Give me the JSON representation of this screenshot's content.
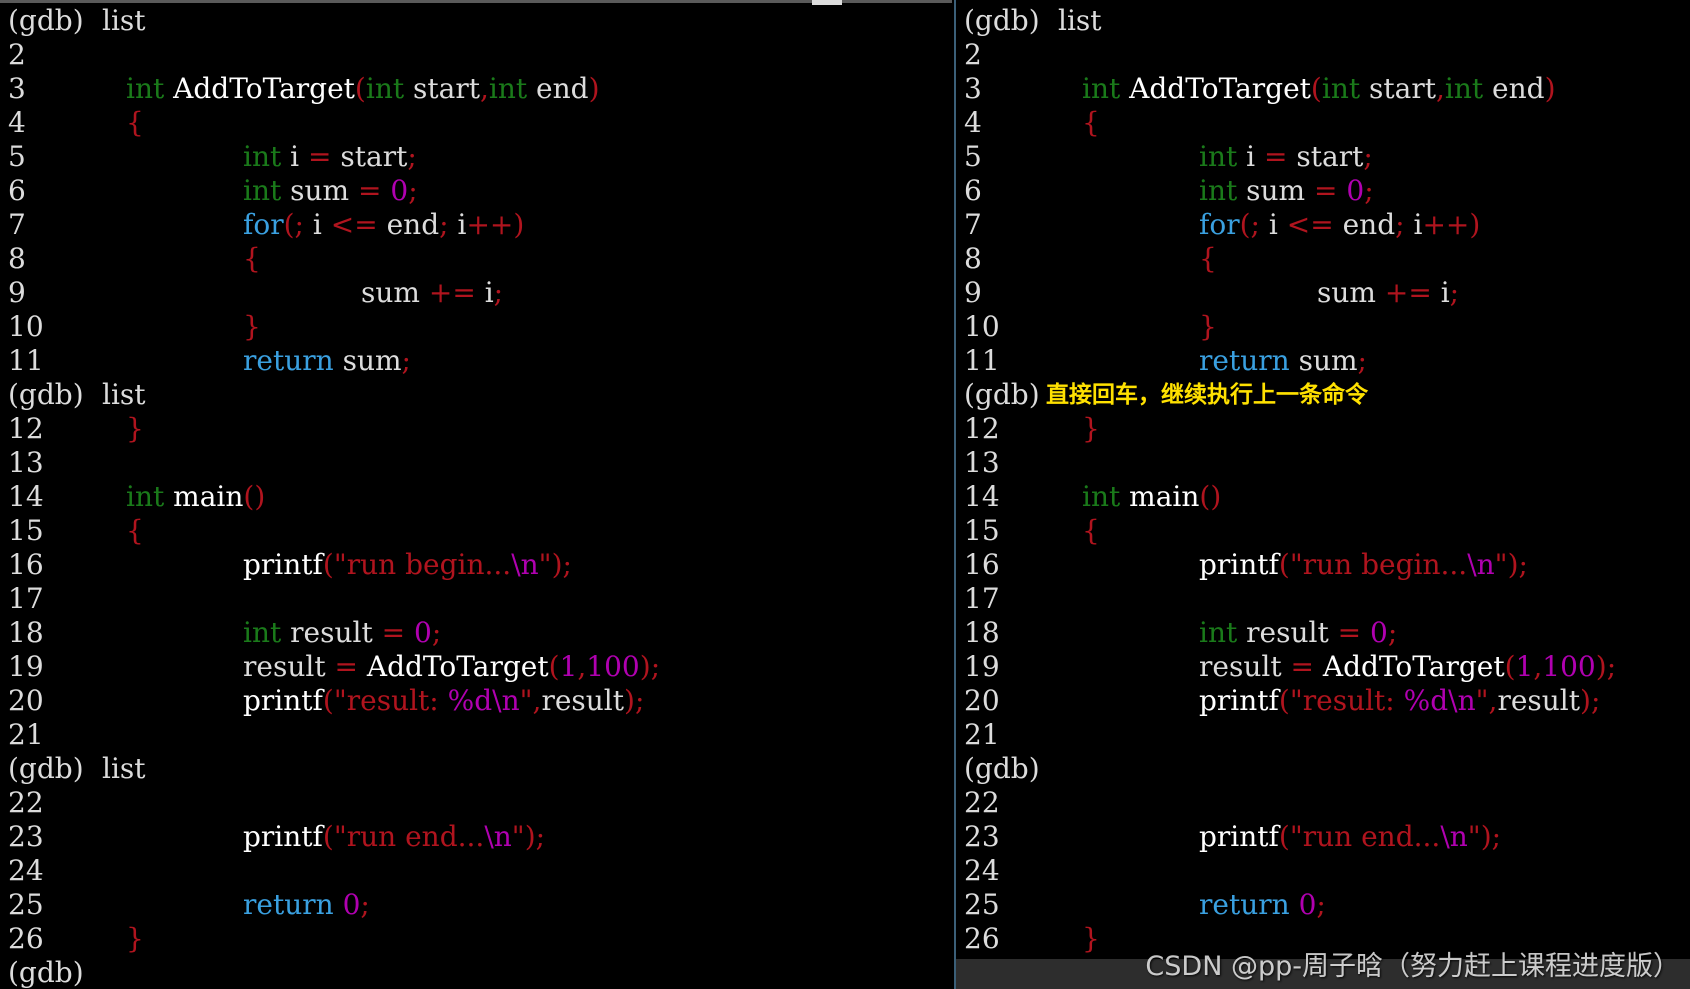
{
  "prompt": "(gdb)",
  "cmd_list": "list",
  "annotation": "直接回车，继续执行上一条命令",
  "watermark": "CSDN @pp-周子晗（努力赶上课程进度版）",
  "colors": {
    "keyword": "#1a7a1a",
    "control": "#3aa0e0",
    "punct": "#b0141e",
    "literal": "#b000b0",
    "annotation": "#ffe100"
  },
  "code": {
    "n2": "2",
    "n3": "3",
    "n4": "4",
    "n5": "5",
    "n6": "6",
    "n7": "7",
    "n8": "8",
    "n9": "9",
    "n10": "10",
    "n11": "11",
    "n12": "12",
    "n13": "13",
    "n14": "14",
    "n15": "15",
    "n16": "16",
    "n17": "17",
    "n18": "18",
    "n19": "19",
    "n20": "20",
    "n21": "21",
    "n22": "22",
    "n23": "23",
    "n24": "24",
    "n25": "25",
    "n26": "26",
    "int": "int",
    "for": "for",
    "return": "return",
    "addToTarget": "AddToTarget",
    "main": "main",
    "printf": "printf",
    "start": "start",
    "end": "end",
    "i": "i",
    "sum": "sum",
    "result": "result",
    "zero": "0",
    "one": "1",
    "hundred": "100",
    "lparen": "(",
    "rparen": ")",
    "comma": ",",
    "semi": ";",
    "lbrace": "{",
    "rbrace": "}",
    "eq": "=",
    "le": "<=",
    "pluseq": "+=",
    "plusplus": "++",
    "emptyparens": "()",
    "str_run_begin": "\"run begin...",
    "str_run_end": "\"run end...",
    "str_result": "\"result: ",
    "esc_n": "\\n",
    "esc_d": "%d",
    "quote": "\""
  }
}
